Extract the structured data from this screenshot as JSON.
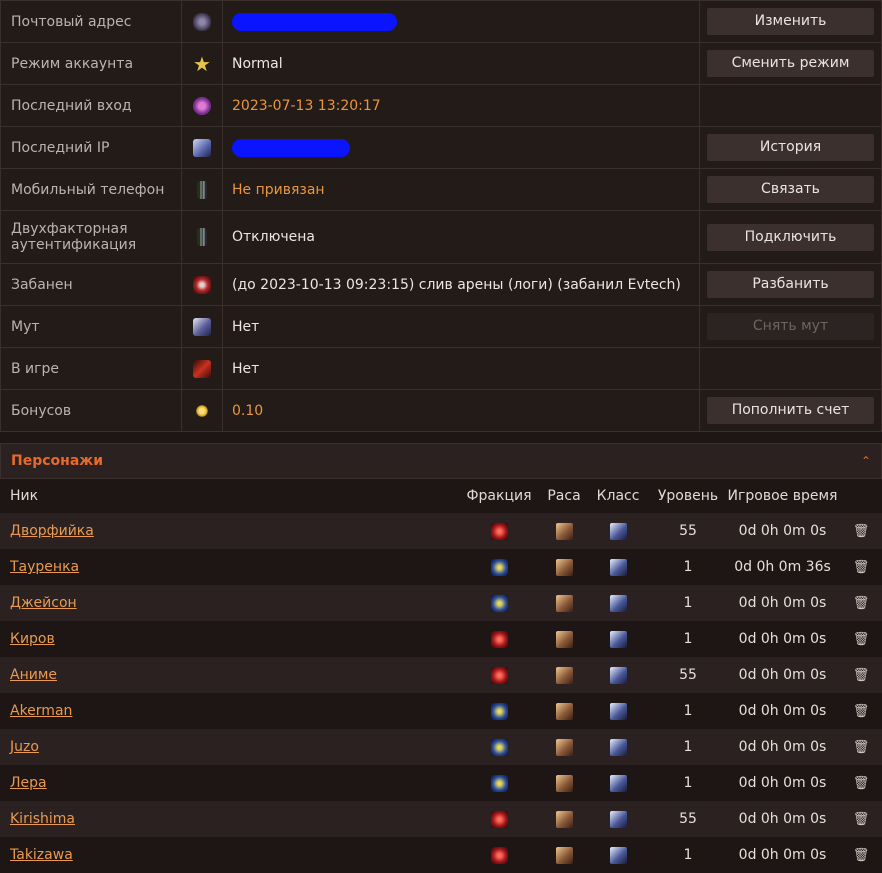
{
  "account": {
    "rows": [
      {
        "label": "Почтовый адрес",
        "icon": "mail-icon",
        "value": "",
        "value_style": "redacted",
        "redact_width": 165,
        "action": "Изменить",
        "action_enabled": true
      },
      {
        "label": "Режим аккаунта",
        "icon": "star-icon",
        "value": "Normal",
        "value_style": "normal",
        "action": "Сменить режим",
        "action_enabled": true
      },
      {
        "label": "Последний вход",
        "icon": "clock-icon",
        "value": "2023-07-13 13:20:17",
        "value_style": "orange",
        "action": "",
        "action_enabled": false
      },
      {
        "label": "Последний IP",
        "icon": "network-icon",
        "value": "",
        "value_style": "redacted",
        "redact_width": 118,
        "action": "История",
        "action_enabled": true
      },
      {
        "label": "Мобильный телефон",
        "icon": "phone-icon",
        "value": "Не привязан",
        "value_style": "orange",
        "action": "Связать",
        "action_enabled": true
      },
      {
        "label": "Двухфакторная аутентификация",
        "icon": "phone-icon",
        "value": "Отключена",
        "value_style": "normal",
        "action": "Подключить",
        "action_enabled": true,
        "tall": true
      },
      {
        "label": "Забанен",
        "icon": "ban-icon",
        "value": "(до 2023-10-13 09:23:15) слив арены (логи) (забанил Evtech)",
        "value_style": "normal",
        "action": "Разбанить",
        "action_enabled": true
      },
      {
        "label": "Мут",
        "icon": "mute-icon",
        "value": "Нет",
        "value_style": "normal",
        "action": "Снять мут",
        "action_enabled": false,
        "action_visible": true
      },
      {
        "label": "В игре",
        "icon": "game-icon",
        "value": "Нет",
        "value_style": "normal",
        "action": "",
        "action_enabled": false
      },
      {
        "label": "Бонусов",
        "icon": "coin-icon",
        "value": "0.10",
        "value_style": "orange",
        "action": "Пополнить счет",
        "action_enabled": true
      }
    ]
  },
  "characters": {
    "title": "Персонажи",
    "columns": [
      "Ник",
      "Фракция",
      "Раса",
      "Класс",
      "Уровень",
      "Игровое время"
    ],
    "rows": [
      {
        "name": "Дворфийка",
        "faction": "horde",
        "level": "55",
        "time": "0d 0h 0m 0s"
      },
      {
        "name": "Тауренка",
        "faction": "alliance",
        "level": "1",
        "time": "0d 0h 0m 36s"
      },
      {
        "name": "Джейсон",
        "faction": "alliance",
        "level": "1",
        "time": "0d 0h 0m 0s"
      },
      {
        "name": "Киров",
        "faction": "horde",
        "level": "1",
        "time": "0d 0h 0m 0s"
      },
      {
        "name": "Аниме",
        "faction": "horde",
        "level": "55",
        "time": "0d 0h 0m 0s"
      },
      {
        "name": "Akerman",
        "faction": "alliance",
        "level": "1",
        "time": "0d 0h 0m 0s"
      },
      {
        "name": "Juzo",
        "faction": "alliance",
        "level": "1",
        "time": "0d 0h 0m 0s"
      },
      {
        "name": "Лера",
        "faction": "alliance",
        "level": "1",
        "time": "0d 0h 0m 0s"
      },
      {
        "name": "Kirishima",
        "faction": "horde",
        "level": "55",
        "time": "0d 0h 0m 0s"
      },
      {
        "name": "Takizawa",
        "faction": "horde",
        "level": "1",
        "time": "0d 0h 0m 0s"
      }
    ]
  }
}
